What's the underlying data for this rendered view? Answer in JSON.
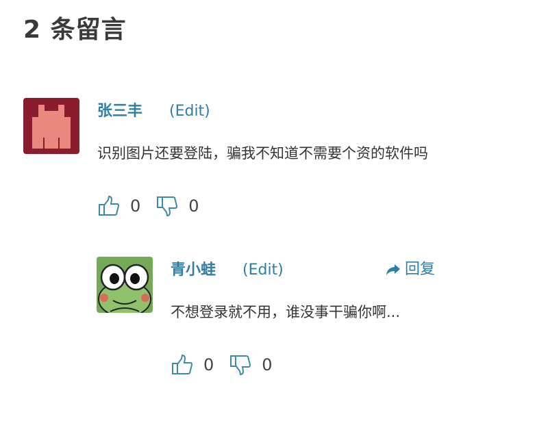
{
  "heading": "2 条留言",
  "comments": [
    {
      "author": "张三丰",
      "edit_label": "(Edit)",
      "text": "识别图片还要登陆，骗我不知道不需要个资的软件吗",
      "likes": "0",
      "dislikes": "0",
      "avatar_icon": "pixel-invader-avatar"
    },
    {
      "author": "青小蛙",
      "edit_label": "(Edit)",
      "reply_label": "回复",
      "text": "不想登录就不用，谁没事干骗你啊...",
      "likes": "0",
      "dislikes": "0",
      "avatar_icon": "frog-avatar"
    }
  ],
  "colors": {
    "link": "#2e7ea6",
    "avatar1_bg": "#8a1c2e",
    "avatar1_fg": "#e8887e",
    "avatar2_bg": "#74a95a"
  }
}
